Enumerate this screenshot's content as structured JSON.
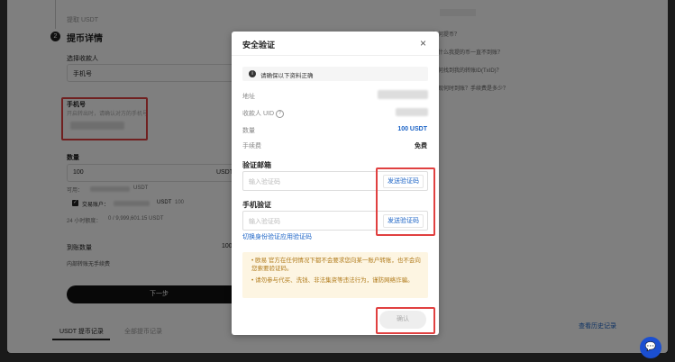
{
  "background": {
    "prev_step_label": "提取 USDT",
    "step_number": "2",
    "step_title": "提币详情",
    "recipient_label": "选择收款人",
    "recipient_value": "手机号",
    "phone_label": "手机号",
    "phone_hint": "开启转出时，请确认对方的手机号",
    "amount_label": "数量",
    "amount_value": "100",
    "amount_unit": "USDT",
    "available_label": "可用：",
    "available_unit": "USDT",
    "account_label": "交易账户：",
    "account_unit": "USDT",
    "account_value": "100",
    "limit_text": "24 小时额度：",
    "limit_value": "0 / 9,999,601.15 USDT",
    "receive_label": "到账数量",
    "receive_value": "100",
    "fee_note": "内部转账无手续费",
    "next_button": "下一步",
    "tab_usdt_history": "USDT 提币记录",
    "tab_all_history": "全部提币记录",
    "faq_1": "如何提币？",
    "faq_2": "为什么我提的币一直不到账？",
    "faq_3": "如何找到我的转账ID(TxID)？",
    "faq_4": "提现何时到账？手续费是多少？",
    "view_history": "查看历史记录"
  },
  "modal": {
    "title": "安全验证",
    "close_icon": "×",
    "notice": "请确保以下资料正确",
    "address_label": "地址",
    "uid_label": "收款人 UID",
    "amount_label": "数量",
    "amount_value": "100 USDT",
    "fee_label": "手续费",
    "fee_value": "免费",
    "email_section": "验证邮箱",
    "email_placeholder": "输入验证码",
    "email_send": "发送验证码",
    "phone_section": "手机验证",
    "phone_placeholder": "输入验证码",
    "phone_send": "发送验证码",
    "switch_link": "切换身份验证应用验证码",
    "warn_1": "欧易 官方在任何情况下都不会要求您向某一账户转账，也不会向您索要验证码。",
    "warn_2": "请勿参与代买、洗钱、非法集资等违法行为，谨防网络诈骗。",
    "confirm_button": "确认"
  },
  "colors": {
    "accent_blue": "#1b63c6",
    "highlight_red": "#e04040",
    "warn_bg": "#fdf5e2",
    "warn_text": "#b07a1a"
  }
}
